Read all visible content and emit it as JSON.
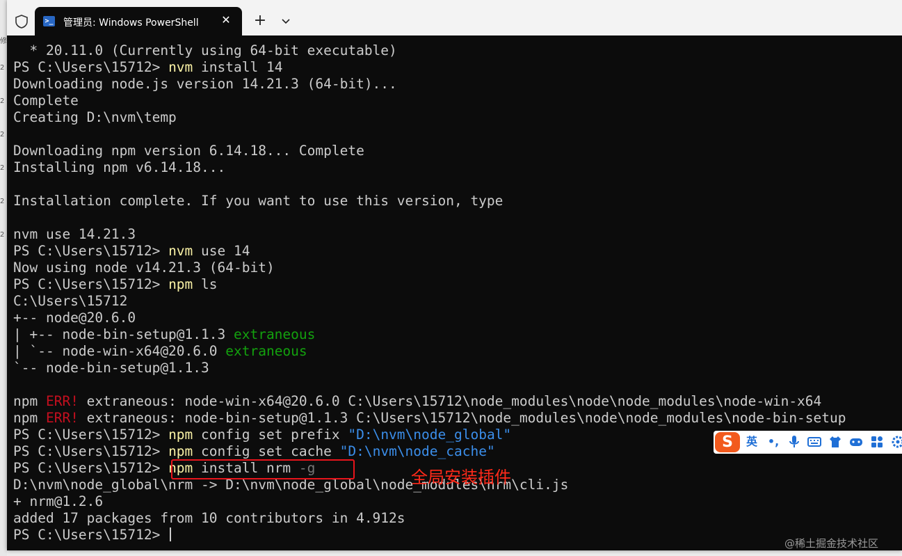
{
  "window": {
    "tab_title": "管理员: Windows PowerShell",
    "tab_icon": "powershell-icon",
    "close_label": "✕",
    "new_tab_label": "+",
    "dropdown_label": "⌄"
  },
  "left_strip": {
    "chars": [
      "修",
      "2",
      "2",
      "2",
      "2",
      "2",
      "2"
    ]
  },
  "terminal": {
    "lines": [
      [
        {
          "t": "  * 20.11.0 (Currently using 64-bit executable)"
        }
      ],
      [
        {
          "t": "PS C:\\Users\\15712> "
        },
        {
          "t": "nvm",
          "c": "y"
        },
        {
          "t": " install 14"
        }
      ],
      [
        {
          "t": "Downloading node.js version 14.21.3 (64-bit)..."
        }
      ],
      [
        {
          "t": "Complete"
        }
      ],
      [
        {
          "t": "Creating D:\\nvm\\temp"
        }
      ],
      [
        {
          "t": ""
        }
      ],
      [
        {
          "t": "Downloading npm version 6.14.18... Complete"
        }
      ],
      [
        {
          "t": "Installing npm v6.14.18..."
        }
      ],
      [
        {
          "t": ""
        }
      ],
      [
        {
          "t": "Installation complete. If you want to use this version, type"
        }
      ],
      [
        {
          "t": ""
        }
      ],
      [
        {
          "t": "nvm use 14.21.3"
        }
      ],
      [
        {
          "t": "PS C:\\Users\\15712> "
        },
        {
          "t": "nvm",
          "c": "y"
        },
        {
          "t": " use 14"
        }
      ],
      [
        {
          "t": "Now using node v14.21.3 (64-bit)"
        }
      ],
      [
        {
          "t": "PS C:\\Users\\15712> "
        },
        {
          "t": "npm",
          "c": "y"
        },
        {
          "t": " ls"
        }
      ],
      [
        {
          "t": "C:\\Users\\15712"
        }
      ],
      [
        {
          "t": "+-- node@20.6.0"
        }
      ],
      [
        {
          "t": "| +-- node-bin-setup@1.1.3 "
        },
        {
          "t": "extraneous",
          "c": "g"
        }
      ],
      [
        {
          "t": "| `-- node-win-x64@20.6.0 "
        },
        {
          "t": "extraneous",
          "c": "g"
        }
      ],
      [
        {
          "t": "`-- node-bin-setup@1.1.3"
        }
      ],
      [
        {
          "t": ""
        }
      ],
      [
        {
          "t": "npm "
        },
        {
          "t": "ERR!",
          "c": "r"
        },
        {
          "t": " extraneous: node-win-x64@20.6.0 C:\\Users\\15712\\node_modules\\node\\node_modules\\node-win-x64"
        }
      ],
      [
        {
          "t": "npm "
        },
        {
          "t": "ERR!",
          "c": "r"
        },
        {
          "t": " extraneous: node-bin-setup@1.1.3 C:\\Users\\15712\\node_modules\\node\\node_modules\\node-bin-setup"
        }
      ],
      [
        {
          "t": "PS C:\\Users\\15712> "
        },
        {
          "t": "npm",
          "c": "y"
        },
        {
          "t": " config set prefix "
        },
        {
          "t": "\"D:\\nvm\\node_global\"",
          "c": "b"
        }
      ],
      [
        {
          "t": "PS C:\\Users\\15712> "
        },
        {
          "t": "npm",
          "c": "y"
        },
        {
          "t": " config set cache "
        },
        {
          "t": "\"D:\\nvm\\node_cache\"",
          "c": "b"
        }
      ],
      [
        {
          "t": "PS C:\\Users\\15712> "
        },
        {
          "t": "npm",
          "c": "y"
        },
        {
          "t": " install nrm "
        },
        {
          "t": "-g",
          "c": "d"
        }
      ],
      [
        {
          "t": "D:\\nvm\\node_global\\nrm -> D:\\nvm\\node_global\\node_modules\\nrm\\cli.js"
        }
      ],
      [
        {
          "t": "+ nrm@1.2.6"
        }
      ],
      [
        {
          "t": "added 17 packages from 10 contributors in 4.912s"
        }
      ],
      [
        {
          "t": "PS C:\\Users\\15712> "
        },
        {
          "cursor": true
        }
      ]
    ]
  },
  "annotation": {
    "text": "全局安装插件",
    "color": "#ff2a1a"
  },
  "ime_toolbar": {
    "logo": "S",
    "lang": "英",
    "punct": "•,",
    "icons": [
      "microphone-icon",
      "keyboard-icon",
      "shirt-icon",
      "gamepad-icon",
      "apps-grid-icon",
      "settings-icon"
    ]
  },
  "watermark": "@稀土掘金技术社区",
  "colors": {
    "background": "#0c0c0c",
    "text": "#cccccc",
    "command": "#f9f1a5",
    "string": "#3b8eea",
    "extraneous": "#13a10e",
    "error": "#c50f1f",
    "param": "#767676",
    "highlight_box": "#e8141b"
  }
}
